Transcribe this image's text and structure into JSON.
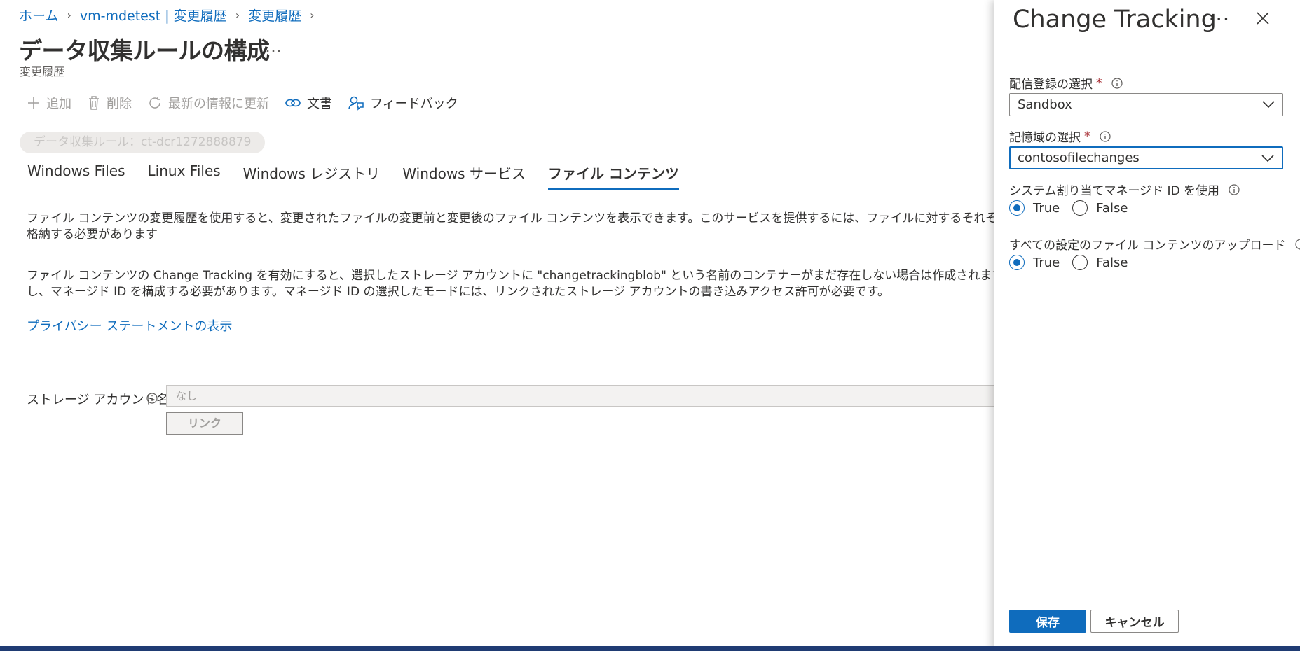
{
  "breadcrumb": {
    "items": [
      "ホーム",
      "vm-mdetest | 変更履歴",
      "変更履歴"
    ]
  },
  "page": {
    "title": "データ収集ルールの構成",
    "more": "…",
    "subtitle": "変更履歴"
  },
  "toolbar": {
    "add": "追加",
    "delete": "削除",
    "refresh": "最新の情報に更新",
    "docs": "文書",
    "feedback": "フィードバック"
  },
  "dcr_pill": "データ収集ルール：ct-dcr1272888879",
  "tabs": [
    "Windows Files",
    "Linux Files",
    "Windows レジストリ",
    "Windows サービス",
    "ファイル コンテンツ"
  ],
  "content": {
    "para1_line1": "ファイル コンテンツの変更履歴を使用すると、変更されたファイルの変更前と変更後のファイル コンテンツを表示できます。このサービスを提供するには、ファイルに対するそれぞれの変更が報告された後に、",
    "para1_line2": "格納する必要があります",
    "para2_line1": "ファイル コンテンツの Change Tracking を有効にすると、選択したストレージ アカウントに \"changetrackingblob\" という名前のコンテナーがまだ存在しない場合は作成されます。ファイル コンテンツの",
    "para2_line2": "し、マネージド ID を構成する必要があります。マネージド ID の選択したモードには、リンクされたストレージ アカウントの書き込みアクセス許可が必要です。",
    "privacy_link": "プライバシー ステートメントの表示",
    "storage_label": "ストレージ アカウント名",
    "storage_value": "なし",
    "link_button": "リンク"
  },
  "panel": {
    "title": "Change Tracking",
    "more": "···",
    "subscription_label": "配信登録の選択",
    "subscription_value": "Sandbox",
    "storage_label": "記憶域の選択",
    "storage_value": "contosofilechanges",
    "required_mark": "*",
    "managed_id_label": "システム割り当てマネージド ID を使用",
    "upload_label": "すべての設定のファイル コンテンツのアップロード",
    "true_label": "True",
    "false_label": "False",
    "save": "保存",
    "cancel": "キャンセル"
  },
  "colors": {
    "accent": "#0f6cbd",
    "required": "#a4262c"
  }
}
